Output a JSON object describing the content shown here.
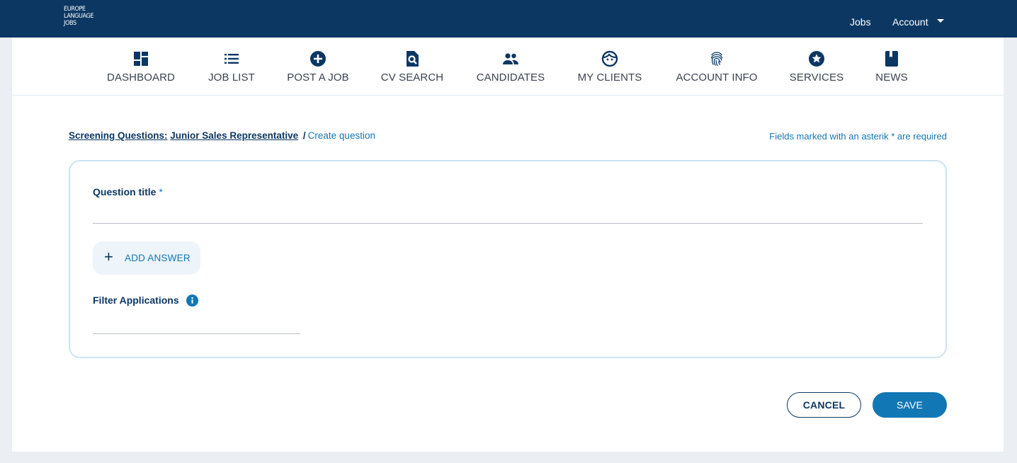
{
  "header": {
    "logo_lines": [
      "Europe",
      "Language",
      "Jobs"
    ],
    "links": {
      "jobs": "Jobs",
      "account": "Account"
    }
  },
  "nav": {
    "items": [
      {
        "label": "DASHBOARD",
        "icon": "dashboard-icon"
      },
      {
        "label": "JOB LIST",
        "icon": "list-icon"
      },
      {
        "label": "POST A JOB",
        "icon": "plus-circle-icon"
      },
      {
        "label": "CV SEARCH",
        "icon": "document-search-icon"
      },
      {
        "label": "CANDIDATES",
        "icon": "people-icon"
      },
      {
        "label": "MY CLIENTS",
        "icon": "face-icon"
      },
      {
        "label": "ACCOUNT INFO",
        "icon": "fingerprint-icon"
      },
      {
        "label": "SERVICES",
        "icon": "star-circle-icon"
      },
      {
        "label": "NEWS",
        "icon": "book-icon"
      }
    ]
  },
  "breadcrumb": {
    "section": "Screening Questions:",
    "job": "Junior Sales Representative",
    "separator": "/",
    "current": "Create question"
  },
  "required_note": "Fields marked with an asterik * are required",
  "form": {
    "title_label": "Question title",
    "title_asterisk": "*",
    "title_value": "",
    "add_answer": {
      "icon": "plus-icon",
      "label": "ADD ANSWER"
    },
    "filter_label": "Filter Applications",
    "filter_info_icon": "info-icon",
    "filter_value": ""
  },
  "actions": {
    "cancel": "CANCEL",
    "save": "SAVE"
  },
  "colors": {
    "navy": "#0c3763",
    "accent_blue": "#1277b5",
    "page_bg": "#ebeef2",
    "card_border": "#cde4ee",
    "add_answer_bg": "#edf4fa"
  }
}
